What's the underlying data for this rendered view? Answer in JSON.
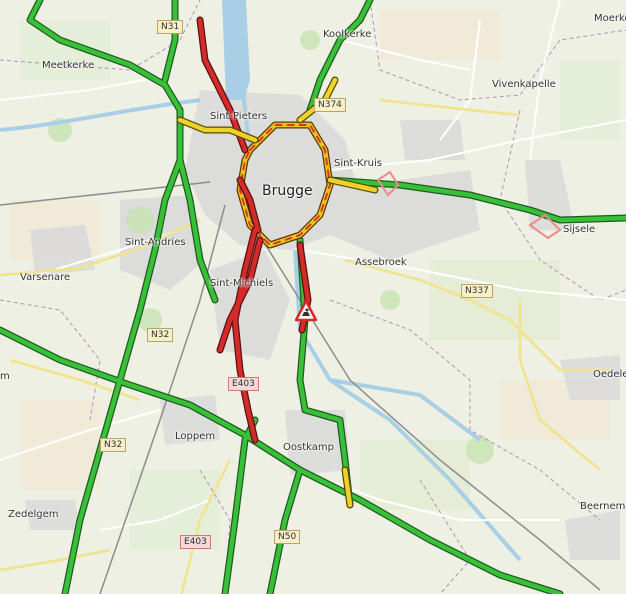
{
  "map": {
    "city": "Brugge",
    "places": [
      {
        "id": "meetkerke",
        "label": "Meetkerke"
      },
      {
        "id": "koolkerke",
        "label": "Koolkerke"
      },
      {
        "id": "vivenkapelle",
        "label": "Vivenkapelle"
      },
      {
        "id": "moerkerke",
        "label": "Moerke"
      },
      {
        "id": "sint-pieters",
        "label": "Sint-Pieters"
      },
      {
        "id": "sint-kruis",
        "label": "Sint-Kruis"
      },
      {
        "id": "sint-andries",
        "label": "Sint-Andries"
      },
      {
        "id": "varsenare",
        "label": "Varsenare"
      },
      {
        "id": "sint-michiels",
        "label": "Sint-Michiels"
      },
      {
        "id": "assebroek",
        "label": "Assebroek"
      },
      {
        "id": "sijsele",
        "label": "Sijsele"
      },
      {
        "id": "oedelem",
        "label": "Oedele"
      },
      {
        "id": "loppem",
        "label": "Loppem"
      },
      {
        "id": "oostkamp",
        "label": "Oostkamp"
      },
      {
        "id": "zedelgem",
        "label": "Zedelgem"
      },
      {
        "id": "beernem",
        "label": "Beernem"
      },
      {
        "id": "left-m",
        "label": "m"
      }
    ],
    "road_shields": [
      {
        "id": "n31-top",
        "label": "N31"
      },
      {
        "id": "n374",
        "label": "N374"
      },
      {
        "id": "n337",
        "label": "N337"
      },
      {
        "id": "n32",
        "label": "N32"
      },
      {
        "id": "n32-south",
        "label": "N32"
      },
      {
        "id": "e403",
        "label": "E403"
      },
      {
        "id": "e403-south",
        "label": "E403"
      },
      {
        "id": "n50",
        "label": "N50"
      }
    ],
    "incident": {
      "icon": "roadworks-warning-icon"
    }
  }
}
